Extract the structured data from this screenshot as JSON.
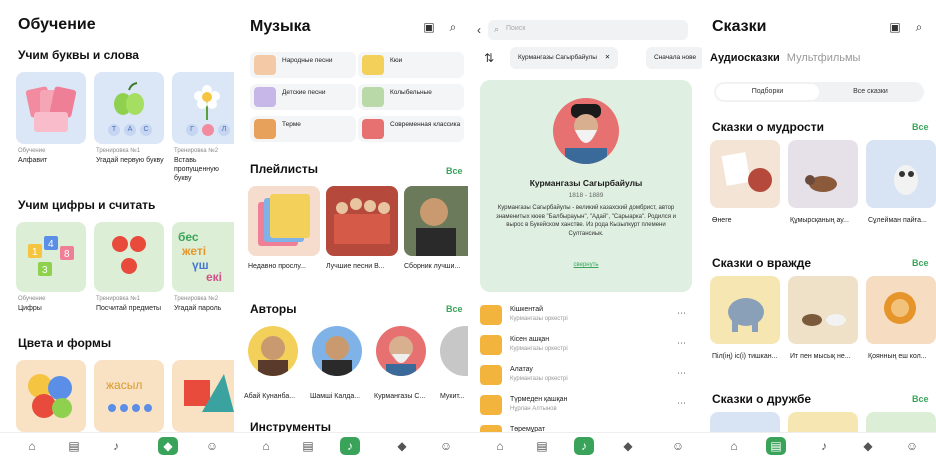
{
  "learning": {
    "title": "Обучение",
    "sec1": "Учим буквы и слова",
    "sec1_cards": [
      {
        "tag": "Обучение",
        "title": "Алфавит"
      },
      {
        "tag": "Тренировка №1",
        "title": "Угадай первую букву"
      },
      {
        "tag": "Тренировка №2",
        "title": "Вставь пропущенную букву"
      }
    ],
    "letters1": [
      "Т",
      "А",
      "С"
    ],
    "letters2": [
      "Г",
      "Л"
    ],
    "sec2": "Учим цифры и считать",
    "sec2_cards": [
      {
        "tag": "Обучение",
        "title": "Цифры"
      },
      {
        "tag": "Тренировка №1",
        "title": "Посчитай предметы"
      },
      {
        "tag": "Тренировка №2",
        "title": "Угадай пароль"
      }
    ],
    "kaz_words": [
      "бес",
      "жеті",
      "үш",
      "екі"
    ],
    "sec3": "Цвета и формы",
    "word_card": "жасыл"
  },
  "music": {
    "title": "Музыка",
    "categories": [
      "Народные песни",
      "Кюи",
      "Детские песни",
      "Колыбельные",
      "Терме",
      "Современная классика"
    ],
    "playlists_title": "Плейлисты",
    "see_all": "Все",
    "playlists": [
      "Недавно прослу...",
      "Лучшие песни В...",
      "Сборник лучши..."
    ],
    "authors_title": "Авторы",
    "authors": [
      "Абай Кунанба...",
      "Шамшi Калда...",
      "Курмангазы С...",
      "Мукит..."
    ],
    "instruments_title": "Инструменты"
  },
  "author_page": {
    "search_placeholder": "Поиск",
    "chip1": "Курмангазы Сагырбайулы",
    "chip2": "Сначала нове",
    "name": "Курмангазы Сагырбайулы",
    "years": "1818 - 1889",
    "bio": "Курмангазы Сагырбайулы - великий казахский домбрист, автор знаменитых кюев \"Балбырауын\", \"Адай\", \"Сарыарка\". Родился и вырос в Букейском ханстве. Из рода Кызылкурт племени Султансиык.",
    "collapse": "свернуть",
    "tracks": [
      {
        "name": "Кішкентай",
        "sub": "Курмангазы оркестрі"
      },
      {
        "name": "Кісен ашқан",
        "sub": "Курмангазы оркестрі"
      },
      {
        "name": "Алатау",
        "sub": "Курмангазы оркестрі"
      },
      {
        "name": "Түрмеден қашқан",
        "sub": "Нұрлан Алтынов"
      },
      {
        "name": "Төремұрат",
        "sub": ""
      }
    ]
  },
  "tales": {
    "title": "Сказки",
    "tab_audio": "Аудиосказки",
    "tab_cartoons": "Мультфильмы",
    "seg1": "Подборки",
    "seg2": "Все сказки",
    "see_all": "Все",
    "wisdom_title": "Сказки о мудрости",
    "wisdom": [
      "Өнеге",
      "Құмырсқаның ау...",
      "Сұлейман пайға..."
    ],
    "enmity_title": "Сказки о вражде",
    "enmity": [
      "Піл(ің) іс(і) тишкан...",
      "Ит пен мысық не...",
      "Қоянның еш кол..."
    ],
    "friendship_title": "Сказки о дружбе"
  },
  "nav": {
    "labels": [
      "Главная",
      "Книги",
      "Музыка",
      "Обучение",
      "Профиль"
    ]
  },
  "colors": {
    "accent": "#3aa35a",
    "card_blue": "#dbe7f6",
    "card_green": "#dcefd6",
    "card_peach": "#f9e1c4",
    "author_bg": "#dff0e2"
  }
}
